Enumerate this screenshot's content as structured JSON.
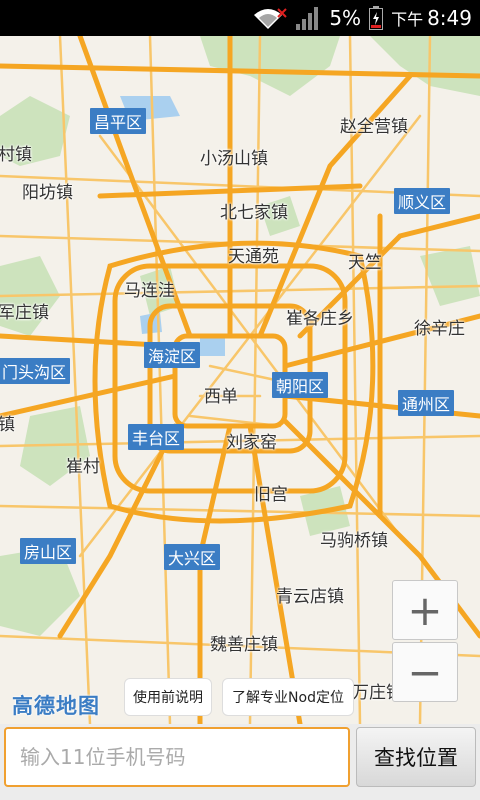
{
  "status_bar": {
    "battery_percent": "5%",
    "time_period": "下午",
    "time": "8:49",
    "icons": [
      "wifi-icon",
      "no-signal-icon",
      "cell-signal-icon",
      "battery-icon"
    ]
  },
  "map": {
    "places": [
      {
        "name": "赵全营镇"
      },
      {
        "name": "小汤山镇"
      },
      {
        "name": "阳坊镇"
      },
      {
        "name": "北七家镇"
      },
      {
        "name": "天通苑"
      },
      {
        "name": "天竺"
      },
      {
        "name": "马连洼"
      },
      {
        "name": "崔各庄乡"
      },
      {
        "name": "徐辛庄"
      },
      {
        "name": "军庄镇"
      },
      {
        "name": "西单"
      },
      {
        "name": "刘家窑"
      },
      {
        "name": "崔村"
      },
      {
        "name": "旧宫"
      },
      {
        "name": "马驹桥镇"
      },
      {
        "name": "青云店镇"
      },
      {
        "name": "魏善庄镇"
      },
      {
        "name": "万庄镇"
      },
      {
        "name": "村镇"
      },
      {
        "name": "镇"
      }
    ],
    "districts": [
      {
        "name": "昌平区"
      },
      {
        "name": "顺义区"
      },
      {
        "name": "海淀区"
      },
      {
        "name": "朝阳区"
      },
      {
        "name": "门头沟区"
      },
      {
        "name": "通州区"
      },
      {
        "name": "丰台区"
      },
      {
        "name": "房山区"
      },
      {
        "name": "大兴区"
      }
    ],
    "zoom_in_label": "+",
    "zoom_out_label": "−",
    "logo_text": "高德地图"
  },
  "info_buttons": {
    "instructions": "使用前说明",
    "learn_more": "了解专业Nod定位"
  },
  "bottom": {
    "phone_placeholder": "输入11位手机号码",
    "phone_value": "",
    "find_button": "查找位置"
  },
  "colors": {
    "road_major": "#f5a623",
    "road_minor": "#f8c66a",
    "district_label_bg": "#3b7dc4",
    "input_border": "#f0a030",
    "green_area": "#cde3bd",
    "water": "#aad0ef"
  }
}
